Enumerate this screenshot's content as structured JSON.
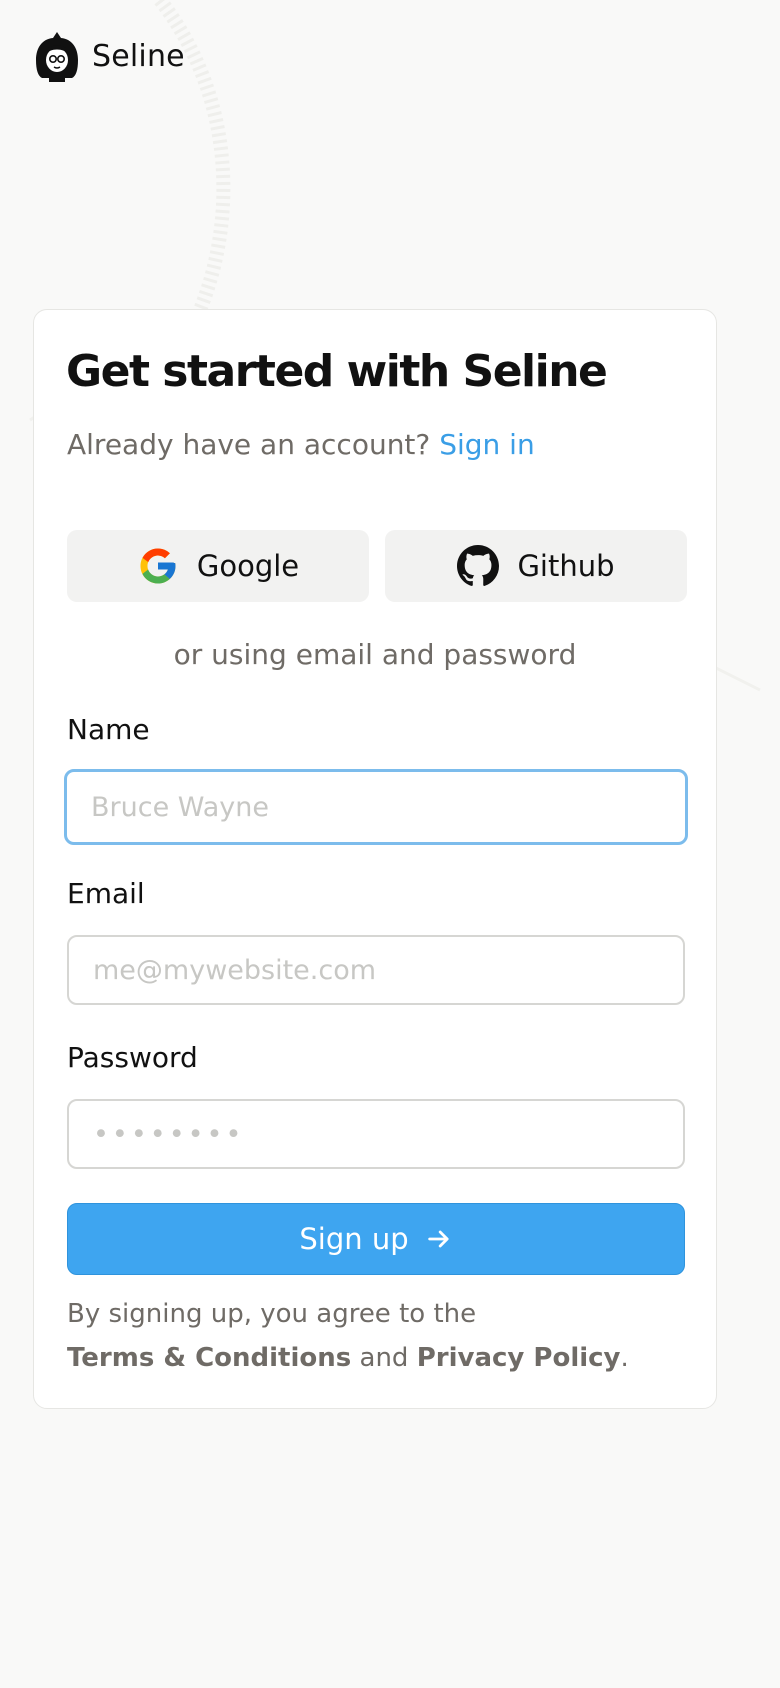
{
  "brand": {
    "name": "Seline",
    "logo_icon": "girl-avatar-logo-icon"
  },
  "card": {
    "title": "Get started with Seline",
    "subtitle_prefix": "Already have an account?",
    "signin_link": "Sign in"
  },
  "oauth": {
    "google_label": "Google",
    "github_label": "Github"
  },
  "divider_text": "or using email and password",
  "form": {
    "name_label": "Name",
    "name_placeholder": "Bruce Wayne",
    "email_label": "Email",
    "email_placeholder": "me@mywebsite.com",
    "password_label": "Password",
    "password_placeholder": "••••••••",
    "submit_label": "Sign up"
  },
  "legal": {
    "prefix": "By signing up, you agree to the",
    "terms": "Terms & Conditions",
    "and": "and",
    "privacy": "Privacy Policy",
    "suffix": "."
  },
  "colors": {
    "accent": "#3ea5f0",
    "link": "#3a9ee6",
    "background": "#f9f9f8",
    "focus_ring": "#7cbcec"
  }
}
